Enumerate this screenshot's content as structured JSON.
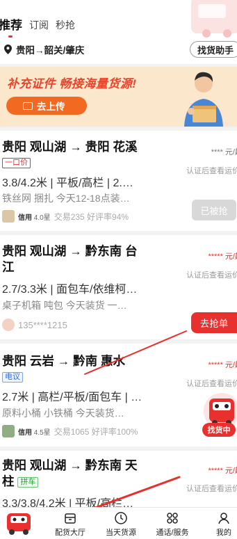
{
  "header": {
    "tabs": [
      {
        "label": "推荐",
        "active": true
      },
      {
        "label": "订阅",
        "active": false
      },
      {
        "label": "秒抢",
        "active": false
      }
    ],
    "route": "贵阳→韶关/肇庆",
    "helper_button": "找货助手"
  },
  "banner": {
    "title": "补充证件 畅接海量货源!",
    "upload_button": "去上传"
  },
  "cards": [
    {
      "route": "贵阳 观山湖 → 贵阳 花溪",
      "tag": "一口价",
      "price": "**** 元/趟",
      "view_price": "认证后查看运价",
      "specs": "3.8/4.2米 | 平板/高栏 | 2.…",
      "goods": "铁丝网 捆扎 今天12-18点装…",
      "credit_label": "信用",
      "credit_value": "4.0星",
      "stats": "交易235 好评率94%",
      "action": "已被抢"
    },
    {
      "route_line1": "贵阳 观山湖 → 黔东南 台",
      "route_line2": "江",
      "price": "***** 元/趟",
      "view_price": "认证后查看运价",
      "specs": "2.7/3.3米 | 面包车/依维柯…",
      "goods": "桌子机箱 吨包 今天装货 一…",
      "phone": "135****1215",
      "action": "去抢单"
    },
    {
      "route": "贵阳 云岩 → 黔南 惠水",
      "tag": "电议",
      "price": "***** 元/趟",
      "view_price": "认证后查看运价",
      "specs": "2.7米 | 高栏/平板/面包车 | …",
      "goods": "原料小桶 小铁桶 今天装货…",
      "credit_label": "信用",
      "credit_value": "4.5星",
      "stats": "交易1065 好评率100%",
      "float_label": "找货中"
    },
    {
      "route_line1": "贵阳 观山湖 → 黔东南 天",
      "route_line2": "柱",
      "tag": "拼车",
      "price": "***** 元/趟",
      "view_price": "认证后查看运价",
      "specs": "3.3/3.8/4.2米 | 平板/高栏…"
    }
  ],
  "bottom_nav": [
    {
      "label": "配货大厅",
      "icon": "cargo-hall-icon"
    },
    {
      "label": "当天货源",
      "icon": "clock-icon"
    },
    {
      "label": "通话/服务",
      "icon": "grid-icon"
    },
    {
      "label": "我的",
      "icon": "user-icon"
    }
  ],
  "colors": {
    "accent": "#e8312f",
    "banner_bg": "#fbe7cb",
    "upload_btn": "#f26a22"
  }
}
